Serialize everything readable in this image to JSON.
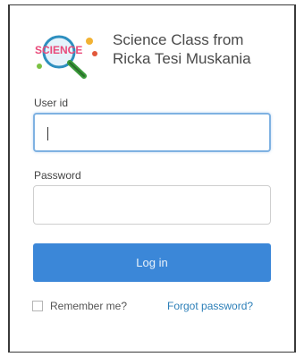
{
  "app": {
    "title_line1": "Science Class from",
    "title_line2": "Ricka Tesi Muskania",
    "logo_text": "SCIENCE"
  },
  "form": {
    "user_label": "User id",
    "user_value": "",
    "password_label": "Password",
    "password_value": "",
    "login_label": "Log in",
    "remember_label": "Remember me?",
    "remember_checked": false,
    "forgot_label": "Forgot password?"
  },
  "colors": {
    "primary": "#3b87d8",
    "link": "#2c7fb8",
    "focus_border": "#7fb2e2"
  },
  "icons": {
    "logo": "science-magnifier-logo"
  }
}
